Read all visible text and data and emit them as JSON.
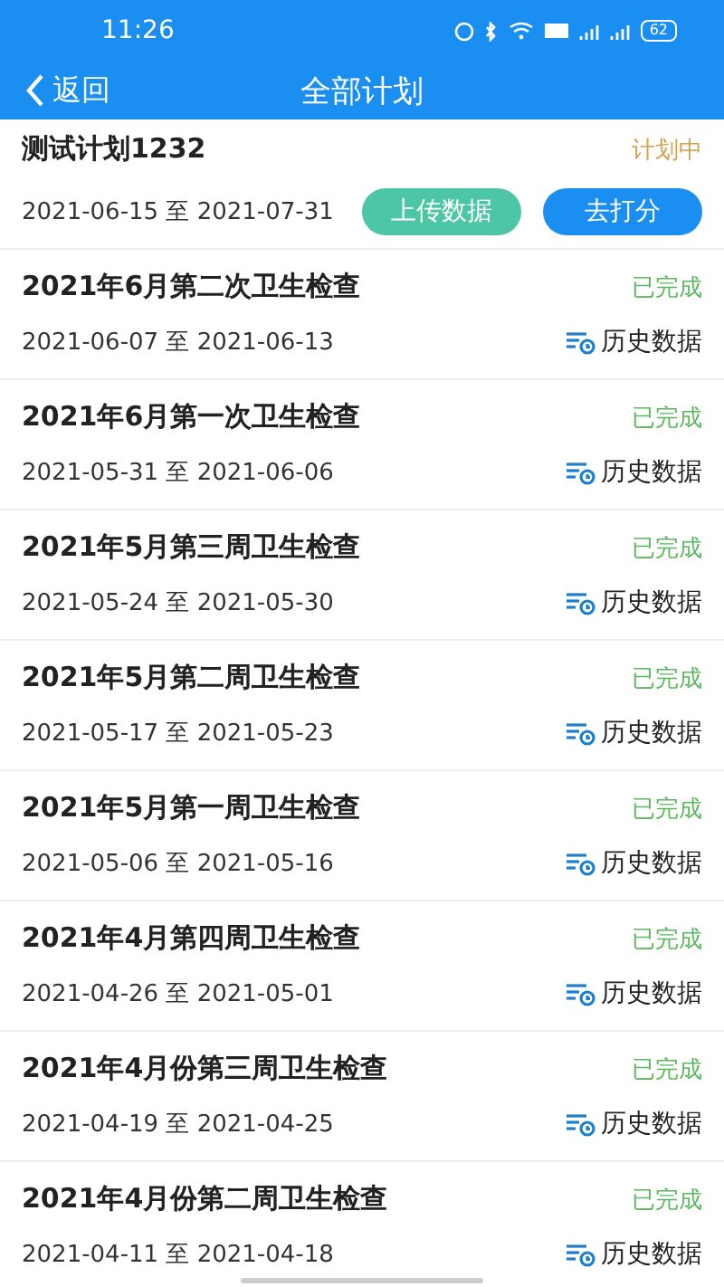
{
  "status_bar": {
    "time": "11:26",
    "battery": "62"
  },
  "nav": {
    "back": "返回",
    "title": "全部计划"
  },
  "plans": [
    {
      "kind": "active",
      "title": "测试计划1232",
      "status": "计划中",
      "color": "#d4a24c",
      "start": "2021-06-15",
      "sep": "至",
      "end": "2021-07-31",
      "buttons": [
        {
          "label": "上传数据",
          "kind": "upload"
        },
        {
          "label": "去打分",
          "kind": "score"
        }
      ]
    },
    {
      "kind": "history",
      "title": "2021年6月第二次卫生检查",
      "status": "已完成",
      "color": "#5cb85c",
      "start": "2021-06-07",
      "sep": "至",
      "end": "2021-06-13",
      "link": "历史数据"
    },
    {
      "kind": "history",
      "title": "2021年6月第一次卫生检查",
      "status": "已完成",
      "color": "#5cb85c",
      "start": "2021-05-31",
      "sep": "至",
      "end": "2021-06-06",
      "link": "历史数据"
    },
    {
      "kind": "history",
      "title": "2021年5月第三周卫生检查",
      "status": "已完成",
      "color": "#5cb85c",
      "start": "2021-05-24",
      "sep": "至",
      "end": "2021-05-30",
      "link": "历史数据"
    },
    {
      "kind": "history",
      "title": "2021年5月第二周卫生检查",
      "status": "已完成",
      "color": "#5cb85c",
      "start": "2021-05-17",
      "sep": "至",
      "end": "2021-05-23",
      "link": "历史数据"
    },
    {
      "kind": "history",
      "title": "2021年5月第一周卫生检查",
      "status": "已完成",
      "color": "#5cb85c",
      "start": "2021-05-06",
      "sep": "至",
      "end": "2021-05-16",
      "link": "历史数据"
    },
    {
      "kind": "history",
      "title": "2021年4月第四周卫生检查",
      "status": "已完成",
      "color": "#5cb85c",
      "start": "2021-04-26",
      "sep": "至",
      "end": "2021-05-01",
      "link": "历史数据"
    },
    {
      "kind": "history",
      "title": "2021年4月份第三周卫生检查",
      "status": "已完成",
      "color": "#5cb85c",
      "start": "2021-04-19",
      "sep": "至",
      "end": "2021-04-25",
      "link": "历史数据"
    },
    {
      "kind": "history",
      "title": "2021年4月份第二周卫生检查",
      "status": "已完成",
      "color": "#5cb85c",
      "start": "2021-04-11",
      "sep": "至",
      "end": "2021-04-18",
      "link": "历史数据"
    }
  ]
}
